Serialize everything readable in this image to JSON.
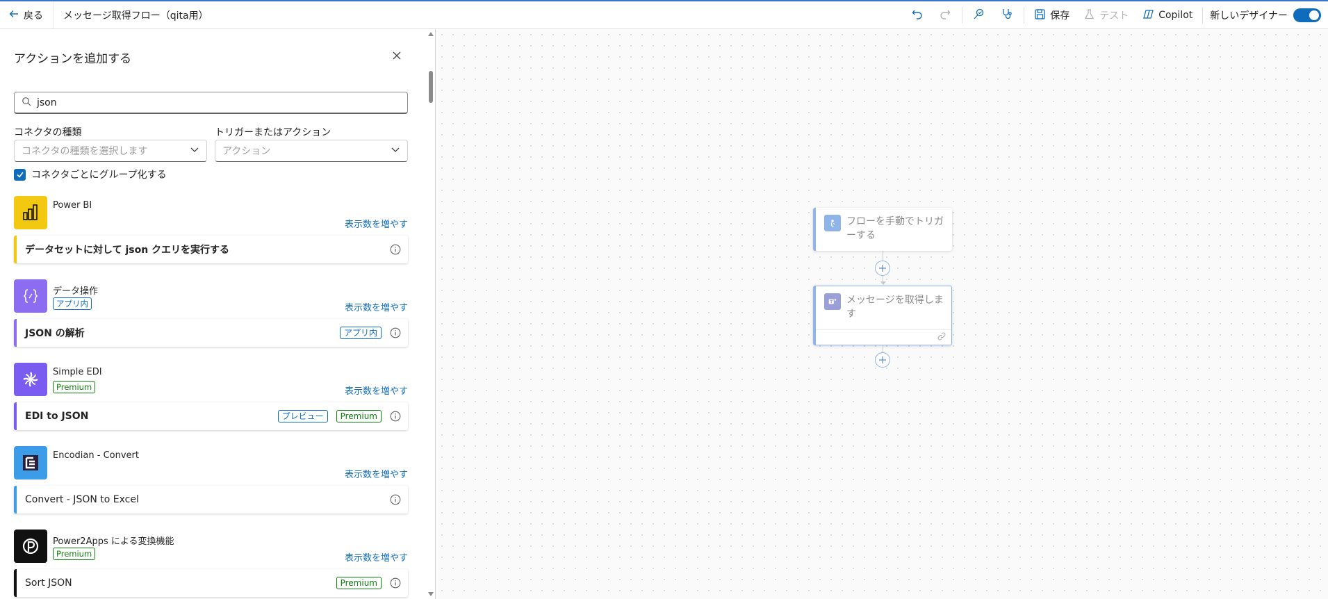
{
  "header": {
    "back_label": "戻る",
    "flow_title": "メッセージ取得フロー（qita用）",
    "save_label": "保存",
    "test_label": "テスト",
    "copilot_label": "Copilot",
    "new_designer_label": "新しいデザイナー",
    "new_designer_enabled": true
  },
  "panel": {
    "title": "アクションを追加する",
    "search_value": "json",
    "connector_type_label": "コネクタの種類",
    "connector_type_placeholder": "コネクタの種類を選択します",
    "trigger_action_label": "トリガーまたはアクション",
    "trigger_action_placeholder": "アクション",
    "group_by_connector_label": "コネクタごとにグループ化する",
    "group_by_connector_checked": true,
    "groups": [
      {
        "name": "Power BI",
        "badge": "",
        "more": "表示数を増やす",
        "icon": "power-bi-icon",
        "color": "#f2c811",
        "action": {
          "label": "データセットに対して json クエリを実行する",
          "badges": []
        }
      },
      {
        "name": "データ操作",
        "badge": "アプリ内",
        "more": "表示数を増やす",
        "icon": "data-operation-icon",
        "color": "#8c6cf0",
        "action": {
          "label": "JSON の解析",
          "badges": [
            "アプリ内"
          ]
        }
      },
      {
        "name": "Simple EDI",
        "badge": "Premium",
        "more": "表示数を増やす",
        "icon": "simple-edi-icon",
        "color": "#7b5cf0",
        "action": {
          "label": "EDI to JSON",
          "badges": [
            "プレビュー",
            "Premium"
          ]
        }
      },
      {
        "name": "Encodian - Convert",
        "badge": "",
        "more": "表示数を増やす",
        "icon": "encodian-icon",
        "color": "#3c9ce8",
        "action": {
          "label": "Convert - JSON to Excel",
          "badges": []
        }
      },
      {
        "name": "Power2Apps による変換機能",
        "badge": "Premium",
        "more": "表示数を増やす",
        "icon": "power2apps-icon",
        "color": "#111111",
        "action": {
          "label": "Sort JSON",
          "badges": [
            "Premium"
          ]
        }
      }
    ]
  },
  "canvas": {
    "nodes": [
      {
        "label": "フローを手動でトリガーする",
        "icon": "manual-trigger-icon"
      },
      {
        "label": "メッセージを取得します",
        "icon": "teams-icon"
      }
    ]
  }
}
